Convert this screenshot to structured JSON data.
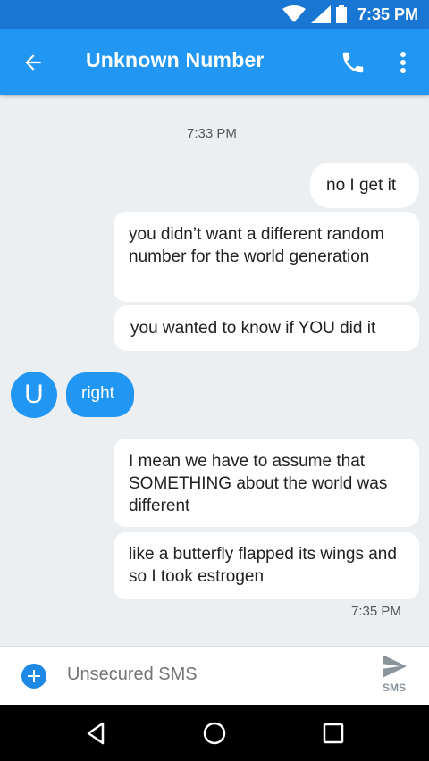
{
  "status": {
    "time": "7:35 PM",
    "icons": [
      "wifi-icon",
      "cell-signal-icon",
      "battery-icon"
    ]
  },
  "appbar": {
    "title": "Unknown Number",
    "back_icon": "arrow-back-icon",
    "call_icon": "phone-icon",
    "more_icon": "more-vert-icon"
  },
  "conversation": {
    "timestamp_top": "7:33 PM",
    "messages": [
      {
        "direction": "out",
        "text": "no I get it"
      },
      {
        "direction": "out",
        "text": "you didn’t want a different random number for the world generation"
      },
      {
        "direction": "out",
        "text": "you wanted to know if YOU did it"
      },
      {
        "direction": "in",
        "avatar_letter": "U",
        "text": "right"
      },
      {
        "direction": "out",
        "text": "I mean we have to assume that SOMETHING about the world was different"
      },
      {
        "direction": "out",
        "text": "like a butterfly flapped its wings and so I took estrogen"
      }
    ],
    "timestamp_bottom": "7:35 PM"
  },
  "composer": {
    "placeholder": "Unsecured SMS",
    "send_label": "SMS"
  },
  "colors": {
    "accent": "#2196f3",
    "statusbar": "#1976d2",
    "background": "#eceff1"
  }
}
